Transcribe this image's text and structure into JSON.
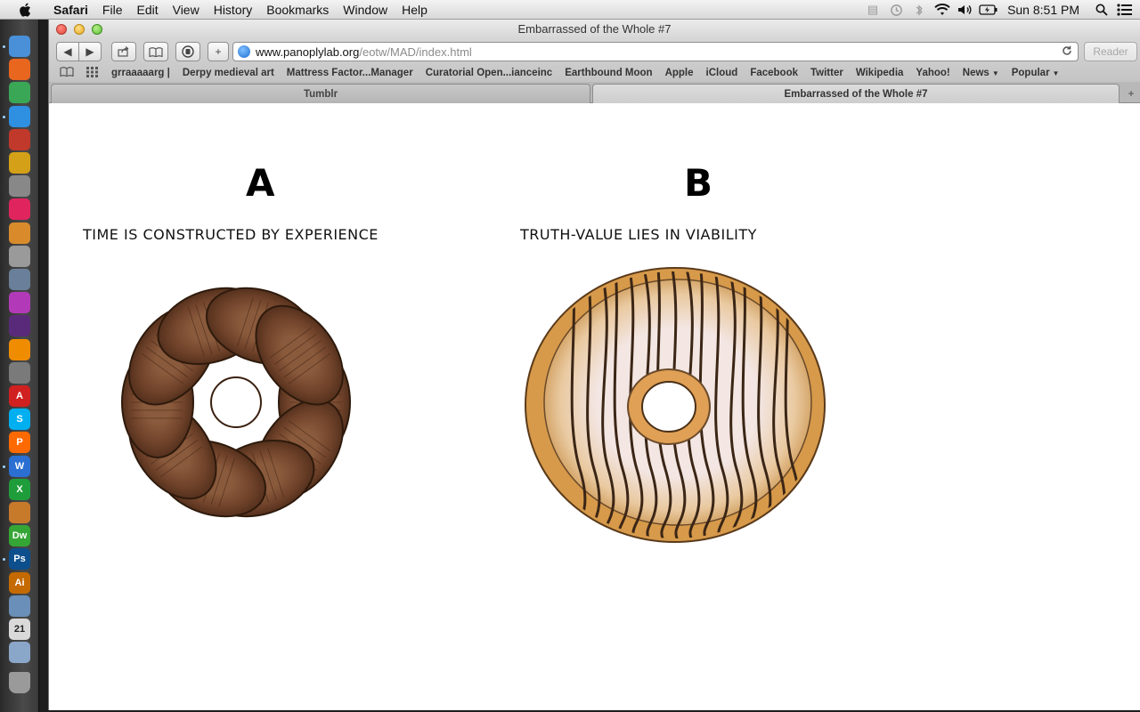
{
  "menubar": {
    "app": "Safari",
    "items": [
      "File",
      "Edit",
      "View",
      "History",
      "Bookmarks",
      "Window",
      "Help"
    ],
    "clock": "Sun 8:51 PM"
  },
  "window": {
    "title": "Embarrassed of the Whole #7",
    "url_host": "www.panoplylab.org",
    "url_path": "/eotw/MAD/index.html",
    "reader_label": "Reader"
  },
  "bookmarks": [
    {
      "label": "grraaaaarg |",
      "menu": false
    },
    {
      "label": "Derpy medieval art",
      "menu": false
    },
    {
      "label": "Mattress Factor...Manager",
      "menu": false
    },
    {
      "label": "Curatorial Open...ianceinc",
      "menu": false
    },
    {
      "label": "Earthbound Moon",
      "menu": false
    },
    {
      "label": "Apple",
      "menu": false
    },
    {
      "label": "iCloud",
      "menu": false
    },
    {
      "label": "Facebook",
      "menu": false
    },
    {
      "label": "Twitter",
      "menu": false
    },
    {
      "label": "Wikipedia",
      "menu": false
    },
    {
      "label": "Yahoo!",
      "menu": false
    },
    {
      "label": "News",
      "menu": true
    },
    {
      "label": "Popular",
      "menu": true
    }
  ],
  "tabs": [
    {
      "label": "Tumblr",
      "active": false
    },
    {
      "label": "Embarrassed of the Whole #7",
      "active": true
    }
  ],
  "content": {
    "option_a": {
      "letter": "A",
      "caption": "TIME IS CONSTRUCTED BY EXPERIENCE"
    },
    "option_b": {
      "letter": "B",
      "caption": "TRUTH-VALUE LIES IN VIABILITY"
    }
  },
  "dock": {
    "items": [
      {
        "icon": "finder-icon",
        "color": "#4a90d9",
        "running": true
      },
      {
        "icon": "firefox-icon",
        "color": "#e8661e",
        "running": false
      },
      {
        "icon": "chrome-icon",
        "color": "#3aa757",
        "running": false
      },
      {
        "icon": "safari-icon",
        "color": "#2f8fe0",
        "running": true
      },
      {
        "icon": "photo-booth-icon",
        "color": "#c0392b",
        "running": false
      },
      {
        "icon": "imovie-star-icon",
        "color": "#d4a017",
        "running": false
      },
      {
        "icon": "dvd-player-icon",
        "color": "#888888",
        "running": false
      },
      {
        "icon": "itunes-icon",
        "color": "#e0245e",
        "running": false
      },
      {
        "icon": "garageband-icon",
        "color": "#d98b2b",
        "running": false
      },
      {
        "icon": "calculator-icon",
        "color": "#9a9a9a",
        "running": false
      },
      {
        "icon": "preview-icon",
        "color": "#6a7f99",
        "running": false
      },
      {
        "icon": "ufo-icon",
        "color": "#b23ab8",
        "running": false
      },
      {
        "icon": "audio-icon",
        "color": "#5a2a7a",
        "running": false
      },
      {
        "icon": "vlc-icon",
        "color": "#f08c00",
        "running": false
      },
      {
        "icon": "system-preferences-icon",
        "color": "#7a7a7a",
        "running": false
      },
      {
        "icon": "acrobat-icon",
        "color": "#d02020",
        "running": false
      },
      {
        "icon": "skype-icon",
        "color": "#00aff0",
        "running": false
      },
      {
        "icon": "pages-icon",
        "color": "#ff6a00",
        "running": false
      },
      {
        "icon": "word-icon",
        "color": "#2a6fd1",
        "running": true
      },
      {
        "icon": "excel-icon",
        "color": "#1f9d3a",
        "running": false
      },
      {
        "icon": "image-tool-icon",
        "color": "#c87a2b",
        "running": false
      },
      {
        "icon": "dreamweaver-icon",
        "color": "#35a635",
        "running": false
      },
      {
        "icon": "photoshop-icon",
        "color": "#0d4f8c",
        "running": true
      },
      {
        "icon": "illustrator-icon",
        "color": "#c46a00",
        "running": false
      },
      {
        "icon": "iphoto-icon",
        "color": "#6a8fb8",
        "running": false
      },
      {
        "icon": "calendar-icon",
        "color": "#d9d9d9",
        "running": false
      },
      {
        "icon": "image-capture-icon",
        "color": "#8aa6c8",
        "running": false
      },
      {
        "icon": "trash-icon",
        "color": "#9a9a9a",
        "running": false
      }
    ],
    "labels": {
      "photoshop": "Ps",
      "illustrator": "Ai",
      "dreamweaver": "Dw",
      "skype": "S",
      "word": "W",
      "excel": "X",
      "acrobat": "A",
      "pages": "P",
      "calendar": "21"
    }
  }
}
